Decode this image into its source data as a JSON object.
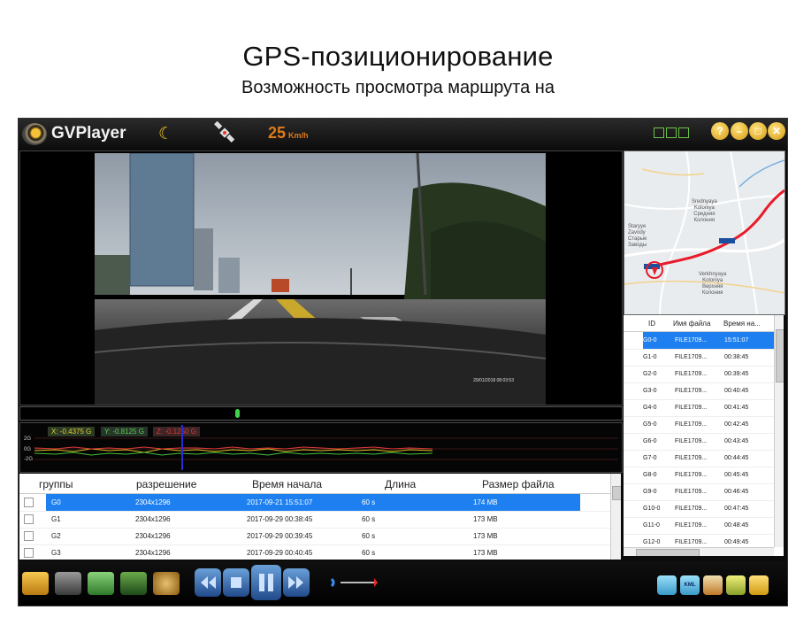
{
  "heading": {
    "title": "GPS-позиционирование",
    "subtitle": "Возможность просмотра маршрута на"
  },
  "app": {
    "name": "GVPlayer",
    "speed_value": "25",
    "speed_unit": "Km/h",
    "window_buttons": [
      "?",
      "–",
      "□",
      "✕"
    ]
  },
  "video": {
    "timestamp": "29/01/2018 08:03:53"
  },
  "gsensor": {
    "x_label": "X: -0.4375 G",
    "y_label": "Y: -0.8125 G",
    "z_label": "Z: -0.1250 G",
    "ticks": [
      "2G",
      "0G",
      "-2G"
    ]
  },
  "map": {
    "labels": [
      "Srednyaya\nKoloniya\nСредняя\nКолония",
      "Staryye\nZavody\nСтарые\nЗаводы",
      "Verkhnyaya\nKoloniya\nВерхняя\nКолония"
    ],
    "route_color": "#e81c2a"
  },
  "groups_table": {
    "headers": [
      "группы",
      "разрешение",
      "Время начала",
      "Длина",
      "Размер файла"
    ],
    "rows": [
      {
        "group": "G0",
        "resolution": "2304x1296",
        "start": "2017-09-21 15:51:07",
        "length": "60 s",
        "size": "174 MB",
        "selected": true
      },
      {
        "group": "G1",
        "resolution": "2304x1296",
        "start": "2017-09-29 00:38:45",
        "length": "60 s",
        "size": "173 MB",
        "selected": false
      },
      {
        "group": "G2",
        "resolution": "2304x1296",
        "start": "2017-09-29 00:39:45",
        "length": "60 s",
        "size": "173 MB",
        "selected": false
      },
      {
        "group": "G3",
        "resolution": "2304x1296",
        "start": "2017-09-29 00:40:45",
        "length": "60 s",
        "size": "173 MB",
        "selected": false
      }
    ]
  },
  "files_table": {
    "headers": [
      "ID",
      "Имя файла",
      "Время на..."
    ],
    "rows": [
      {
        "id": "G0-0",
        "name": "FILE1709...",
        "time": "15:51:07",
        "selected": true
      },
      {
        "id": "G1-0",
        "name": "FILE1709...",
        "time": "00:38:45",
        "selected": false
      },
      {
        "id": "G2-0",
        "name": "FILE1709...",
        "time": "00:39:45",
        "selected": false
      },
      {
        "id": "G3-0",
        "name": "FILE1709...",
        "time": "00:40:45",
        "selected": false
      },
      {
        "id": "G4-0",
        "name": "FILE1709...",
        "time": "00:41:45",
        "selected": false
      },
      {
        "id": "G5-0",
        "name": "FILE1709...",
        "time": "00:42:45",
        "selected": false
      },
      {
        "id": "G6-0",
        "name": "FILE1709...",
        "time": "00:43:45",
        "selected": false
      },
      {
        "id": "G7-0",
        "name": "FILE1709...",
        "time": "00:44:45",
        "selected": false
      },
      {
        "id": "G8-0",
        "name": "FILE1709...",
        "time": "00:45:45",
        "selected": false
      },
      {
        "id": "G9-0",
        "name": "FILE1709...",
        "time": "00:46:45",
        "selected": false
      },
      {
        "id": "G10-0",
        "name": "FILE1709...",
        "time": "00:47:45",
        "selected": false
      },
      {
        "id": "G11-0",
        "name": "FILE1709...",
        "time": "00:48:45",
        "selected": false
      },
      {
        "id": "G12-0",
        "name": "FILE1709...",
        "time": "00:49:45",
        "selected": false
      }
    ]
  },
  "toolbar": {
    "kml_label": "KML"
  },
  "playback": {
    "seek_fraction": 0.36
  },
  "colors": {
    "selection": "#1e80f0",
    "speed": "#e07a18",
    "gx": "#e0d02a",
    "gy": "#5ad24a",
    "gz": "#e83030"
  }
}
